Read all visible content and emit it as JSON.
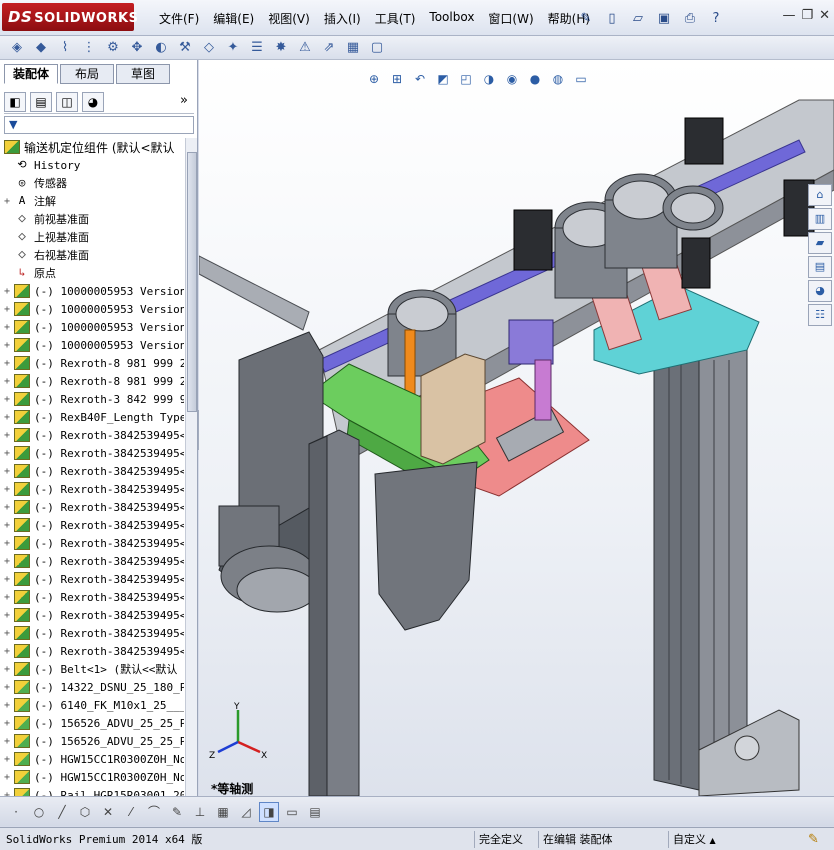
{
  "app": {
    "brand_prefix": "DS",
    "brand_name": "SOLIDWORKS"
  },
  "menu": {
    "items": [
      "文件(F)",
      "编辑(E)",
      "视图(V)",
      "插入(I)",
      "工具(T)",
      "Toolbox",
      "窗口(W)",
      "帮助(H)"
    ]
  },
  "window_controls": {
    "help_glyph": "?",
    "minimize": "—",
    "restore": "❐",
    "close": "✕"
  },
  "panel": {
    "cm_tabs": [
      "装配体",
      "布局",
      "草图"
    ],
    "more_glyph": "»",
    "filter_glyph": "▼"
  },
  "tree": {
    "root": "输送机定位组件  (默认<默认",
    "items": [
      {
        "label": "History",
        "icon": "history-icon",
        "expand": ""
      },
      {
        "label": "传感器",
        "icon": "sensor-icon",
        "expand": ""
      },
      {
        "label": "注解",
        "icon": "annotation-icon",
        "expand": "+"
      },
      {
        "label": "前视基准面",
        "icon": "plane-icon",
        "expand": ""
      },
      {
        "label": "上视基准面",
        "icon": "plane-icon",
        "expand": ""
      },
      {
        "label": "右视基准面",
        "icon": "plane-icon",
        "expand": ""
      },
      {
        "label": "原点",
        "icon": "origin-icon",
        "expand": ""
      },
      {
        "label": "(-) 10000005953 Version",
        "icon": "assembly-icon",
        "expand": "+"
      },
      {
        "label": "(-) 10000005953 Version",
        "icon": "assembly-icon",
        "expand": "+"
      },
      {
        "label": "(-) 10000005953 Version",
        "icon": "assembly-icon",
        "expand": "+"
      },
      {
        "label": "(-) 10000005953 Version",
        "icon": "assembly-icon",
        "expand": "+"
      },
      {
        "label": "(-) Rexroth-8 981 999 2",
        "icon": "assembly-icon",
        "expand": "+"
      },
      {
        "label": "(-) Rexroth-8 981 999 2",
        "icon": "assembly-icon",
        "expand": "+"
      },
      {
        "label": "(-) Rexroth-3 842 999 9",
        "icon": "assembly-icon",
        "expand": "+"
      },
      {
        "label": "(-) RexB40F_Length Type",
        "icon": "assembly-icon",
        "expand": "+"
      },
      {
        "label": "(-) Rexroth-3842539495<",
        "icon": "assembly-icon",
        "expand": "+"
      },
      {
        "label": "(-) Rexroth-3842539495<",
        "icon": "assembly-icon",
        "expand": "+"
      },
      {
        "label": "(-) Rexroth-3842539495<",
        "icon": "assembly-icon",
        "expand": "+"
      },
      {
        "label": "(-) Rexroth-3842539495<",
        "icon": "assembly-icon",
        "expand": "+"
      },
      {
        "label": "(-) Rexroth-3842539495<",
        "icon": "assembly-icon",
        "expand": "+"
      },
      {
        "label": "(-) Rexroth-3842539495<",
        "icon": "assembly-icon",
        "expand": "+"
      },
      {
        "label": "(-) Rexroth-3842539495<",
        "icon": "assembly-icon",
        "expand": "+"
      },
      {
        "label": "(-) Rexroth-3842539495<",
        "icon": "assembly-icon",
        "expand": "+"
      },
      {
        "label": "(-) Rexroth-3842539495<",
        "icon": "assembly-icon",
        "expand": "+"
      },
      {
        "label": "(-) Rexroth-3842539495<",
        "icon": "assembly-icon",
        "expand": "+"
      },
      {
        "label": "(-) Rexroth-3842539495<",
        "icon": "assembly-icon",
        "expand": "+"
      },
      {
        "label": "(-) Rexroth-3842539495<",
        "icon": "assembly-icon",
        "expand": "+"
      },
      {
        "label": "(-) Rexroth-3842539495<",
        "icon": "assembly-icon",
        "expand": "+"
      },
      {
        "label": "(-) Belt<1> (默认<<默认",
        "icon": "assembly-icon",
        "expand": "+"
      },
      {
        "label": "(-) 14322_DSNU_25_180_P",
        "icon": "part-icon",
        "expand": "+"
      },
      {
        "label": "(-) 6140_FK_M10x1_25___",
        "icon": "part-icon",
        "expand": "+"
      },
      {
        "label": "(-) 156526_ADVU_25_25_P",
        "icon": "part-icon",
        "expand": "+"
      },
      {
        "label": "(-) 156526_ADVU_25_25_P",
        "icon": "part-icon",
        "expand": "+"
      },
      {
        "label": "(-) HGW15CC1R0300Z0H_No",
        "icon": "part-icon",
        "expand": "+"
      },
      {
        "label": "(-) HGW15CC1R0300Z0H_No",
        "icon": "part-icon",
        "expand": "+"
      },
      {
        "label": "(-) Rail_HGR15R03001_20",
        "icon": "part-icon",
        "expand": "+"
      }
    ]
  },
  "viewport": {
    "view_label": "*等轴测",
    "triad": {
      "x": "X",
      "y": "Y",
      "z": "Z"
    }
  },
  "status": {
    "product": "SolidWorks Premium 2014 x64 版",
    "constraint": "完全定义",
    "mode": "在编辑 装配体",
    "units": "自定义",
    "units_arrow": "▲"
  },
  "colors": {
    "accent": "#c41e22",
    "viewport_top": "#ffffff",
    "viewport_bottom": "#dde2ec",
    "rail_purple": "#6f68d8",
    "plate_cyan": "#5fd2d6",
    "plate_pink": "#ee8b8b",
    "frame_green": "#6ccd5e",
    "profile_gray": "#5f646d"
  }
}
